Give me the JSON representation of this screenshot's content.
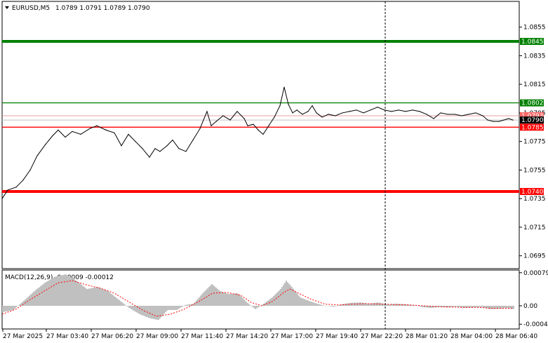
{
  "header": {
    "symbol": "EURUSD,M5",
    "ohlc": "1.0789 1.0791 1.0789 1.0790",
    "menu_icon": "triangle-down-icon"
  },
  "macd": {
    "label": "MACD(12,26,9) -0.00009 -0.00012",
    "hist_color": "#c0c0c0",
    "signal_color": "#ff0000"
  },
  "colors": {
    "support_resistance_green": "#008000",
    "support_resistance_red": "#ff0000",
    "price_line": "#000000",
    "bid_line": "#c0c0c0",
    "crosshair": "#000000"
  },
  "chart_data": {
    "type": "line",
    "symbol": "EURUSD",
    "timeframe": "M5",
    "ylim": [
      1.0686,
      1.0873
    ],
    "y_ticks": [
      "1.0855",
      "1.0835",
      "1.0815",
      "1.0795",
      "1.0775",
      "1.0755",
      "1.0735",
      "1.0715",
      "1.0695"
    ],
    "y_tick_values": [
      1.0855,
      1.0835,
      1.0815,
      1.0795,
      1.0775,
      1.0755,
      1.0735,
      1.0715,
      1.0695
    ],
    "x_ticks": [
      "27 Mar 2025",
      "27 Mar 03:40",
      "27 Mar 06:20",
      "27 Mar 09:00",
      "27 Mar 11:40",
      "27 Mar 14:20",
      "27 Mar 17:00",
      "27 Mar 19:40",
      "27 Mar 22:20",
      "28 Mar 01:20",
      "28 Mar 04:00",
      "28 Mar 06:40"
    ],
    "levels": [
      {
        "label": "1.0845",
        "value": 1.0845,
        "color": "#008000",
        "thick": true
      },
      {
        "label": "1.0802",
        "value": 1.0802,
        "color": "#008000",
        "thick": false
      },
      {
        "label": "1.0785",
        "value": 1.0785,
        "color": "#ff0000",
        "thick": false
      },
      {
        "label": "1.0740",
        "value": 1.074,
        "color": "#ff0000",
        "thick": true
      }
    ],
    "current_price": {
      "label": "1.0790",
      "value": 1.079
    },
    "bid_price": {
      "label": "1.0793",
      "value": 1.0793
    },
    "price_series": [
      [
        0,
        1.0735
      ],
      [
        8,
        1.0741
      ],
      [
        20,
        1.0743
      ],
      [
        30,
        1.0748
      ],
      [
        40,
        1.0755
      ],
      [
        50,
        1.0765
      ],
      [
        62,
        1.0773
      ],
      [
        72,
        1.0779
      ],
      [
        80,
        1.0783
      ],
      [
        90,
        1.0778
      ],
      [
        100,
        1.0782
      ],
      [
        112,
        1.078
      ],
      [
        125,
        1.0784
      ],
      [
        135,
        1.0786
      ],
      [
        148,
        1.0783
      ],
      [
        160,
        1.0781
      ],
      [
        170,
        1.0772
      ],
      [
        180,
        1.078
      ],
      [
        190,
        1.0775
      ],
      [
        200,
        1.077
      ],
      [
        210,
        1.0764
      ],
      [
        218,
        1.077
      ],
      [
        225,
        1.0768
      ],
      [
        235,
        1.0772
      ],
      [
        243,
        1.0776
      ],
      [
        252,
        1.077
      ],
      [
        262,
        1.0768
      ],
      [
        272,
        1.0776
      ],
      [
        282,
        1.0784
      ],
      [
        292,
        1.0796
      ],
      [
        298,
        1.0786
      ],
      [
        305,
        1.0789
      ],
      [
        315,
        1.0793
      ],
      [
        325,
        1.079
      ],
      [
        335,
        1.0796
      ],
      [
        345,
        1.0791
      ],
      [
        350,
        1.0786
      ],
      [
        358,
        1.0787
      ],
      [
        365,
        1.0783
      ],
      [
        372,
        1.078
      ],
      [
        380,
        1.0786
      ],
      [
        388,
        1.0792
      ],
      [
        396,
        1.08
      ],
      [
        402,
        1.0813
      ],
      [
        408,
        1.0801
      ],
      [
        414,
        1.0795
      ],
      [
        420,
        1.0797
      ],
      [
        428,
        1.0794
      ],
      [
        436,
        1.0796
      ],
      [
        442,
        1.08
      ],
      [
        448,
        1.0795
      ],
      [
        456,
        1.0792
      ],
      [
        465,
        1.0794
      ],
      [
        475,
        1.0793
      ],
      [
        485,
        1.0795
      ],
      [
        495,
        1.0796
      ],
      [
        505,
        1.0797
      ],
      [
        515,
        1.0795
      ],
      [
        525,
        1.0797
      ],
      [
        535,
        1.0799
      ],
      [
        545,
        1.0797
      ],
      [
        555,
        1.0796
      ],
      [
        565,
        1.0797
      ],
      [
        575,
        1.0796
      ],
      [
        585,
        1.0797
      ],
      [
        595,
        1.0796
      ],
      [
        605,
        1.0794
      ],
      [
        615,
        1.0791
      ],
      [
        625,
        1.0795
      ],
      [
        635,
        1.0794
      ],
      [
        645,
        1.0794
      ],
      [
        655,
        1.0793
      ],
      [
        665,
        1.0794
      ],
      [
        675,
        1.0795
      ],
      [
        685,
        1.0793
      ],
      [
        692,
        1.079
      ],
      [
        700,
        1.0789
      ],
      [
        708,
        1.0789
      ],
      [
        715,
        1.079
      ],
      [
        722,
        1.0791
      ],
      [
        728,
        1.079
      ]
    ],
    "macd": {
      "ylim": [
        -0.00052,
        0.00082
      ],
      "y_ticks": [
        "0.00079",
        "0.00",
        "-0.00044"
      ],
      "y_tick_values": [
        0.00079,
        0.0,
        -0.00044
      ],
      "histogram": [
        [
          0,
          -0.00015
        ],
        [
          15,
          -0.0001
        ],
        [
          30,
          0.00012
        ],
        [
          45,
          0.00035
        ],
        [
          60,
          0.00055
        ],
        [
          75,
          0.0007
        ],
        [
          90,
          0.00075
        ],
        [
          105,
          0.0006
        ],
        [
          120,
          0.0004
        ],
        [
          135,
          0.00045
        ],
        [
          150,
          0.00035
        ],
        [
          165,
          0.00015
        ],
        [
          180,
          -5e-05
        ],
        [
          195,
          -0.0002
        ],
        [
          210,
          -0.0003
        ],
        [
          222,
          -0.00034
        ],
        [
          235,
          -0.0001
        ],
        [
          248,
          -0.0001
        ],
        [
          260,
          2e-05
        ],
        [
          272,
          5e-05
        ],
        [
          285,
          0.0003
        ],
        [
          298,
          0.00052
        ],
        [
          310,
          0.00035
        ],
        [
          322,
          0.00028
        ],
        [
          335,
          0.0003
        ],
        [
          348,
          8e-05
        ],
        [
          360,
          -8e-05
        ],
        [
          372,
          5e-05
        ],
        [
          384,
          0.0002
        ],
        [
          396,
          0.0004
        ],
        [
          404,
          0.0006
        ],
        [
          412,
          0.00045
        ],
        [
          424,
          0.0002
        ],
        [
          436,
          0.00012
        ],
        [
          448,
          5e-05
        ],
        [
          460,
          0.0
        ],
        [
          472,
          -2e-05
        ],
        [
          484,
          4e-05
        ],
        [
          496,
          7e-05
        ],
        [
          510,
          8e-05
        ],
        [
          522,
          5e-05
        ],
        [
          535,
          8e-05
        ],
        [
          548,
          3e-05
        ],
        [
          560,
          5e-05
        ],
        [
          572,
          4e-05
        ],
        [
          585,
          2e-05
        ],
        [
          598,
          -3e-05
        ],
        [
          610,
          -5e-05
        ],
        [
          622,
          -3e-05
        ],
        [
          634,
          -4e-05
        ],
        [
          646,
          -2e-05
        ],
        [
          658,
          -5e-05
        ],
        [
          670,
          -4e-05
        ],
        [
          682,
          -3e-05
        ],
        [
          694,
          -8e-05
        ],
        [
          706,
          -7e-05
        ],
        [
          718,
          -5e-05
        ],
        [
          728,
          -8e-05
        ]
      ],
      "signal": [
        [
          0,
          -0.0002
        ],
        [
          20,
          -8e-05
        ],
        [
          40,
          0.00015
        ],
        [
          60,
          0.00035
        ],
        [
          80,
          0.00055
        ],
        [
          100,
          0.0006
        ],
        [
          120,
          0.0005
        ],
        [
          140,
          0.00042
        ],
        [
          160,
          0.0003
        ],
        [
          180,
          0.0001
        ],
        [
          200,
          -0.0001
        ],
        [
          220,
          -0.00025
        ],
        [
          240,
          -0.0002
        ],
        [
          260,
          -8e-05
        ],
        [
          280,
          0.0001
        ],
        [
          300,
          0.0003
        ],
        [
          320,
          0.00032
        ],
        [
          340,
          0.00025
        ],
        [
          355,
          8e-05
        ],
        [
          370,
          0.0
        ],
        [
          385,
          0.0001
        ],
        [
          400,
          0.0003
        ],
        [
          410,
          0.0004
        ],
        [
          425,
          0.00028
        ],
        [
          440,
          0.00016
        ],
        [
          460,
          4e-05
        ],
        [
          480,
          2e-05
        ],
        [
          500,
          4e-05
        ],
        [
          520,
          5e-05
        ],
        [
          540,
          4e-05
        ],
        [
          560,
          3e-05
        ],
        [
          580,
          2e-05
        ],
        [
          600,
          0.0
        ],
        [
          620,
          -2e-05
        ],
        [
          640,
          -3e-05
        ],
        [
          660,
          -4e-05
        ],
        [
          680,
          -4e-05
        ],
        [
          700,
          -6e-05
        ],
        [
          728,
          -6e-05
        ]
      ]
    }
  }
}
